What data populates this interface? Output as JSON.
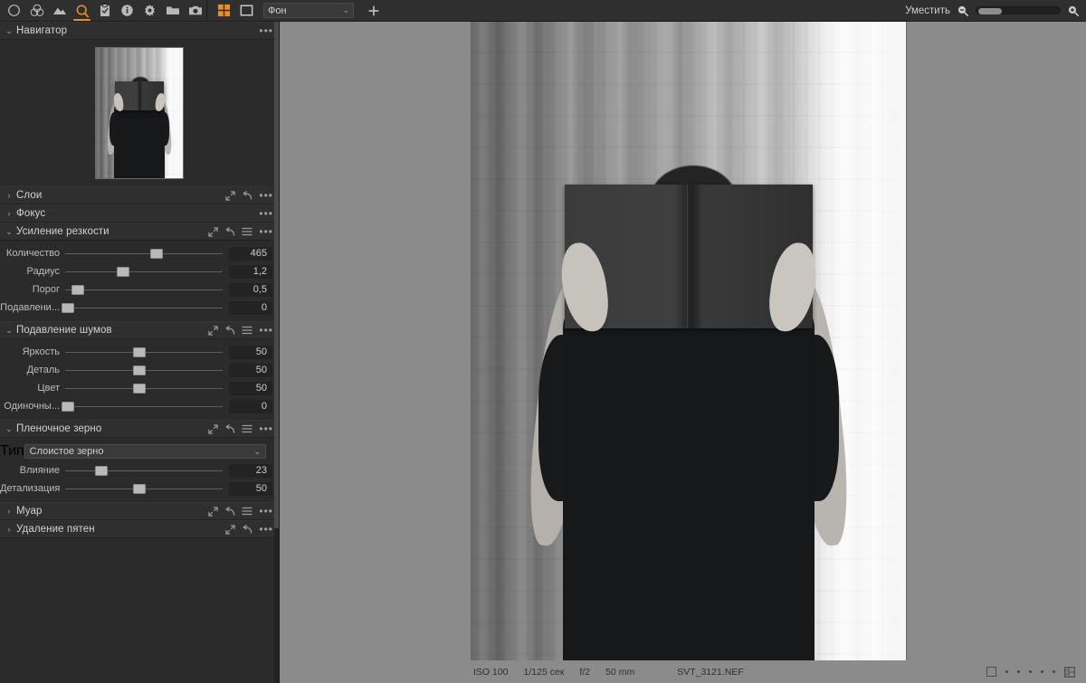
{
  "app": {
    "accent": "#f08c20",
    "panel_bg": "#2b2b2b",
    "viewer_bg": "#8b8b8b"
  },
  "toolbar": {
    "tools": [
      {
        "name": "circle-tool-icon",
        "title": "Circle"
      },
      {
        "name": "color-wheel-icon",
        "title": "Color"
      },
      {
        "name": "landscape-icon",
        "title": "Landscape"
      },
      {
        "name": "magnifier-detail-icon",
        "title": "Detail"
      },
      {
        "name": "clipboard-icon",
        "title": "Clipboard"
      },
      {
        "name": "info-icon",
        "title": "Info"
      },
      {
        "name": "gear-icon",
        "title": "Settings"
      },
      {
        "name": "folder-icon",
        "title": "Folder"
      },
      {
        "name": "camera-icon",
        "title": "Camera"
      }
    ],
    "active_tool_index": 3,
    "view_modes": [
      {
        "name": "grid-view-icon",
        "active": true
      },
      {
        "name": "single-view-icon",
        "active": false
      }
    ],
    "layer_combo": {
      "value": "Фон",
      "chevron": "⌄"
    },
    "add_icon": "plus-icon",
    "zoom_label": "Уместить",
    "zoom_out_icon": "zoom-out-icon",
    "zoom_in_icon": "zoom-in-icon"
  },
  "sidebar": {
    "sections": [
      {
        "id": "navigator",
        "title": "Навигатор",
        "expanded": true,
        "arrow": "⌄",
        "tools": [
          "ellipsis"
        ]
      },
      {
        "id": "layers",
        "title": "Слои",
        "expanded": false,
        "arrow": "›",
        "tools": [
          "expand",
          "reset",
          "ellipsis"
        ]
      },
      {
        "id": "focus",
        "title": "Фокус",
        "expanded": false,
        "arrow": "›",
        "tools": [
          "ellipsis"
        ]
      },
      {
        "id": "sharpening",
        "title": "Усиление резкости",
        "expanded": true,
        "arrow": "⌄",
        "tools": [
          "expand",
          "reset",
          "menu",
          "ellipsis"
        ],
        "sliders": [
          {
            "label": "Количество",
            "value": "465",
            "pct": 58
          },
          {
            "label": "Радиус",
            "value": "1,2",
            "pct": 37
          },
          {
            "label": "Порог",
            "value": "0,5",
            "pct": 8
          },
          {
            "label": "Подавлени...",
            "value": "0",
            "pct": 2
          }
        ]
      },
      {
        "id": "noise-reduction",
        "title": "Подавление шумов",
        "expanded": true,
        "arrow": "⌄",
        "tools": [
          "expand",
          "reset",
          "menu",
          "ellipsis"
        ],
        "sliders": [
          {
            "label": "Яркость",
            "value": "50",
            "pct": 47
          },
          {
            "label": "Деталь",
            "value": "50",
            "pct": 47
          },
          {
            "label": "Цвет",
            "value": "50",
            "pct": 47
          },
          {
            "label": "Одиночны...",
            "value": "0",
            "pct": 2
          }
        ]
      },
      {
        "id": "film-grain",
        "title": "Пленочное зерно",
        "expanded": true,
        "arrow": "⌄",
        "tools": [
          "expand",
          "reset",
          "menu",
          "ellipsis"
        ],
        "type_row": {
          "label": "Тип",
          "value": "Слоистое зерно",
          "chevron": "⌄"
        },
        "sliders": [
          {
            "label": "Влияние",
            "value": "23",
            "pct": 23
          },
          {
            "label": "Детализация",
            "value": "50",
            "pct": 47
          }
        ]
      },
      {
        "id": "moire",
        "title": "Муар",
        "expanded": false,
        "arrow": "›",
        "tools": [
          "expand",
          "reset",
          "menu",
          "ellipsis"
        ]
      },
      {
        "id": "spot-removal",
        "title": "Удаление пятен",
        "expanded": false,
        "arrow": "›",
        "tools": [
          "expand",
          "reset",
          "ellipsis"
        ]
      }
    ]
  },
  "viewer": {
    "image_name": "monochrome-portrait-person-holding-book",
    "exif": {
      "iso": "ISO 100",
      "shutter": "1/125 сек",
      "aperture": "f/2",
      "focal": "50 mm",
      "filename": "SVT_3121.NEF"
    },
    "pager": {
      "dots": 5,
      "square_icon": "single-page-icon",
      "grid_icon": "grid-page-icon"
    }
  }
}
